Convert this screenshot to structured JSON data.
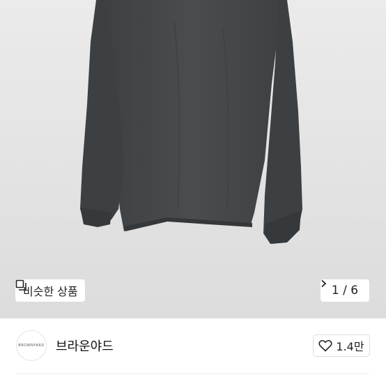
{
  "product_image": {
    "alt": "dark charcoal long sleeve t-shirt",
    "shirt_color": "#45484a"
  },
  "similar_products": {
    "label": "비슷한 상품",
    "icon": "similar-products-icon"
  },
  "image_counter": {
    "current": "1",
    "separator": "/",
    "total": "6"
  },
  "store": {
    "name": "브라운야드",
    "logo_text": "BROWNYARD"
  },
  "like": {
    "count": "1.4만",
    "icon": "heart-icon"
  }
}
